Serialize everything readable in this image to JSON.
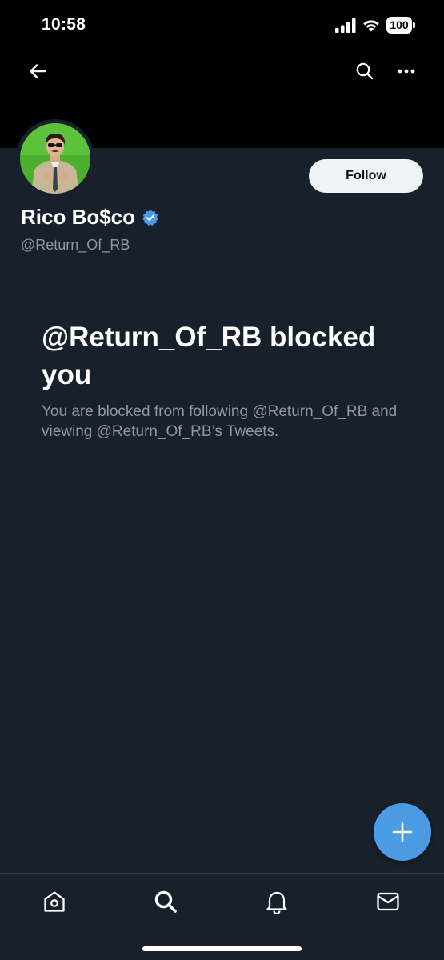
{
  "status_bar": {
    "time": "10:58",
    "battery": "100"
  },
  "profile": {
    "name": "Rico Bo$co",
    "handle": "@Return_Of_RB",
    "verified": true,
    "follow_label": "Follow"
  },
  "blocked": {
    "title": "@Return_Of_RB blocked you",
    "description": "You are blocked from following @Return_Of_RB and viewing @Return_Of_RB’s Tweets."
  },
  "icons": {
    "back": "arrow-left-icon",
    "search": "search-icon",
    "more": "more-horizontal-icon",
    "compose": "plus-icon",
    "home": "home-icon",
    "nav_search": "search-icon",
    "notifications": "bell-icon",
    "messages": "mail-icon"
  },
  "colors": {
    "background": "#17202b",
    "accent": "#4b9ae4",
    "secondary_text": "#8b98a5",
    "avatar_bg": "#4caf2e"
  }
}
